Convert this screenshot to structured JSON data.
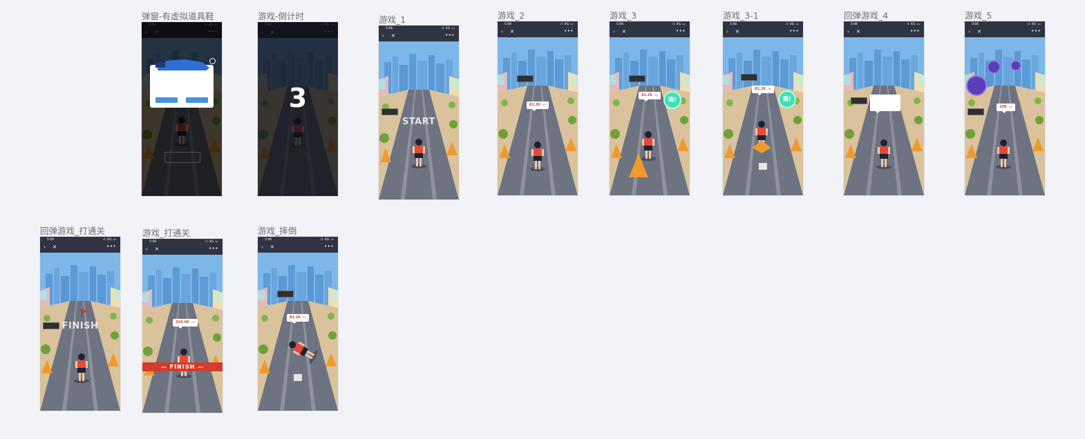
{
  "colors": {
    "background": "#f2f3f7",
    "sky": "#7bb3e6",
    "road": "#6d7380",
    "navbar": "#303342",
    "accent_red": "#d33c2e",
    "jump_green": "#3fe0b6",
    "popup_button": "#4a90e2"
  },
  "status_bar": {
    "time": "5:06",
    "signal": "ıl 4G ▭"
  },
  "navbar": {
    "back_icon": "‹",
    "close_icon": "✕",
    "more_icon": "•••"
  },
  "frames": [
    {
      "id": "popup",
      "label": "弹窗-有虚拟道具鞋"
    },
    {
      "id": "countdown",
      "label": "游戏-倒计时",
      "countdown": "3"
    },
    {
      "id": "game1",
      "label": "游戏_1",
      "start": "START"
    },
    {
      "id": "game2",
      "label": "游戏_2",
      "score": "81.26",
      "unit": "KM"
    },
    {
      "id": "game3",
      "label": "游戏_3",
      "score": "81.26",
      "unit": "KM",
      "jump": "跳!"
    },
    {
      "id": "game3_1",
      "label": "游戏_3-1",
      "score": "81.26",
      "unit": "KM",
      "jump": "跳!"
    },
    {
      "id": "bounce4",
      "label": "回弹游戏_4"
    },
    {
      "id": "game5",
      "label": "游戏_5",
      "score": "100",
      "unit": "KM"
    },
    {
      "id": "bounce_finish",
      "label": "回弹游戏_打通关",
      "finish": "FINISH"
    },
    {
      "id": "game_finish",
      "label": "游戏_打通关",
      "score": "310.99",
      "unit": "KM",
      "finish": "— FINISH —"
    },
    {
      "id": "game_fall",
      "label": "游戏_摔倒",
      "score": "81.26",
      "unit": "KM"
    }
  ]
}
